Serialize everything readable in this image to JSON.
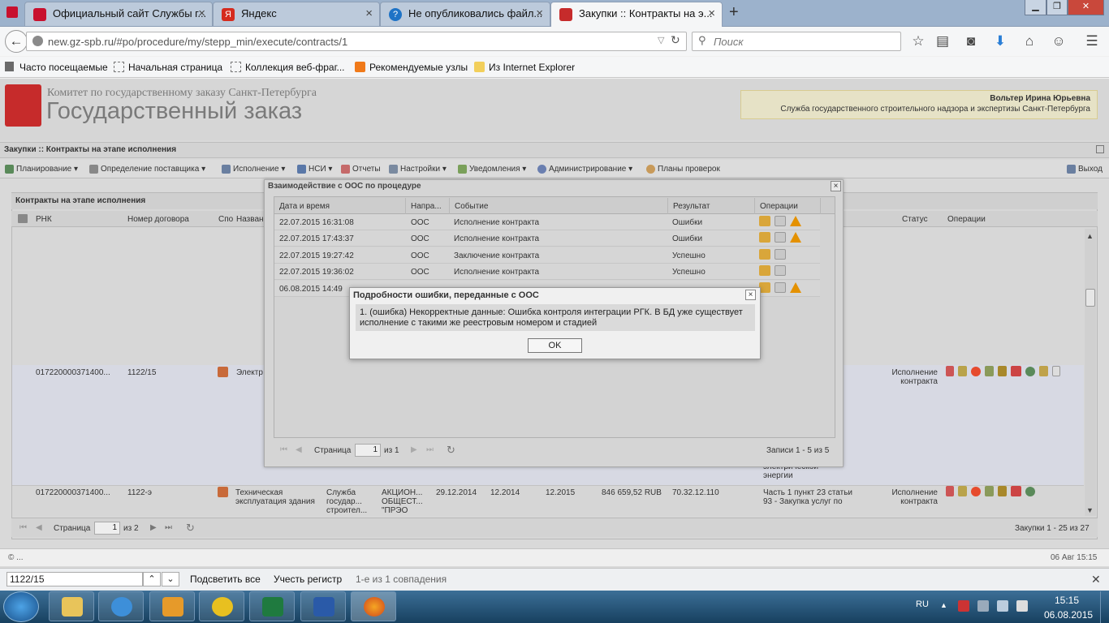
{
  "browser": {
    "tabs": [
      {
        "label": "Официальный сайт Службы г...",
        "icon_color": "#c8102e"
      },
      {
        "label": "Яндекс",
        "icon_color": "#d52b1e"
      },
      {
        "label": "Не опубликовались файл...",
        "icon_color": "#1e73c6"
      },
      {
        "label": "Закупки :: Контракты на э...",
        "icon_color": "#c62b2b"
      }
    ],
    "new_tab": "+",
    "url": "new.gz-spb.ru/#po/procedure/my/stepp_min/execute/contracts/1",
    "search_placeholder": "Поиск",
    "bookmarks": [
      "Часто посещаемые",
      "Начальная страница",
      "Коллекция веб-фраг...",
      "Рекомендуемые узлы",
      "Из Internet Explorer"
    ]
  },
  "site": {
    "org": "Комитет по государственному заказу Санкт-Петербурга",
    "title": "Государственный заказ",
    "user_name": "Вольтер Ирина Юрьевна",
    "user_org": "Служба государственного строительного надзора и экспертизы Санкт-Петербурга",
    "breadcrumb": "Закупки :: Контракты на этапе исполнения",
    "menu": [
      "Планирование",
      "Определение поставщика",
      "Исполнение",
      "НСИ",
      "Отчеты",
      "Настройки",
      "Уведомления",
      "Администрирование",
      "Планы проверок"
    ],
    "exit": "Выход"
  },
  "grid": {
    "title": "Контракты на этапе исполнения",
    "headers": [
      "РНК",
      "Номер договора",
      "Спо",
      "Назван",
      "Статус",
      "Операции"
    ],
    "rows": [
      {
        "rnk": "017220000371400...",
        "number": "1122/15",
        "name": "Электр",
        "status": "Исполнение контракта",
        "extra": "электрической энергии"
      },
      {
        "rnk": "017220000371400...",
        "number": "1122-э",
        "name": "Техническая эксплуатация здания",
        "customer": "Служба государ... строител...",
        "supplier": "АКЦИОН... ОБЩЕСТ... \"ПРЭО",
        "date": "29.12.2014",
        "start": "12.2014",
        "end": "12.2015",
        "sum": "846 659,52 RUB",
        "okpd": "70.32.12.110",
        "basis": "Часть 1 пункт 23 статьи 93 - Закупка услуг по",
        "status": "Исполнение контракта"
      }
    ],
    "page_label": "Страница",
    "page_value": "1",
    "page_of": "из 2",
    "records": "Закупки 1 - 25 из 27"
  },
  "window": {
    "title": "Взаимодействие с ООС по процедуре",
    "headers": [
      "Дата и время",
      "Напра...",
      "Событие",
      "Результат",
      "Операции"
    ],
    "rows": [
      {
        "dt": "22.07.2015 16:31:08",
        "dir": "ООС",
        "event": "Исполнение контракта",
        "result": "Ошибки",
        "warn": true
      },
      {
        "dt": "22.07.2015 17:43:37",
        "dir": "ООС",
        "event": "Исполнение контракта",
        "result": "Ошибки",
        "warn": true
      },
      {
        "dt": "22.07.2015 19:27:42",
        "dir": "ООС",
        "event": "Заключение контракта",
        "result": "Успешно",
        "warn": false
      },
      {
        "dt": "22.07.2015 19:36:02",
        "dir": "ООС",
        "event": "Исполнение контракта",
        "result": "Успешно",
        "warn": false
      },
      {
        "dt": "06.08.2015 14:49",
        "dir": "",
        "event": "",
        "result": "",
        "warn": true
      }
    ],
    "page_label": "Страница",
    "page_value": "1",
    "page_of": "из 1",
    "records": "Записи 1 - 5 из 5"
  },
  "dialog": {
    "title": "Подробности ошибки, переданные с ООС",
    "message": "1. (ошибка) Некорректные данные: Ошибка контроля интеграции РГК. В БД уже существует исполнение с такими же реестровым номером и стадией",
    "ok": "OK"
  },
  "status": {
    "left": "© ...",
    "right": "06 Авг 15:15"
  },
  "findbar": {
    "value": "1122/15",
    "highlight_all": "Подсветить все",
    "match_case": "Учесть регистр",
    "matches": "1-е из 1 совпадения"
  },
  "taskbar": {
    "lang": "RU",
    "time": "15:15",
    "date": "06.08.2015"
  }
}
